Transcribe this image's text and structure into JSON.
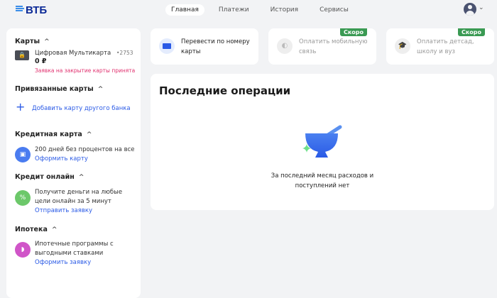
{
  "header": {
    "logo": "ВТБ",
    "nav": [
      "Главная",
      "Платежи",
      "История",
      "Сервисы"
    ]
  },
  "sidebar": {
    "cards": {
      "title": "Карты",
      "card_name": "Цифровая Мультикарта",
      "card_number": "•2753",
      "balance": "0 ₽",
      "notice": "Заявка на закрытие карты принята"
    },
    "linked": {
      "title": "Привязанные карты",
      "add": "Добавить карту другого банка"
    },
    "credit_card": {
      "title": "Кредитная карта",
      "text": "200 дней без процентов на все",
      "link": "Оформить карту"
    },
    "credit_online": {
      "title": "Кредит онлайн",
      "text1": "Получите деньги на любые",
      "text2": "цели онлайн за 5 минут",
      "link": "Отправить заявку"
    },
    "mortgage": {
      "title": "Ипотека",
      "text1": "Ипотечные программы с",
      "text2": "выгодными ставками",
      "link": "Оформить заявку"
    }
  },
  "quick": [
    {
      "l1": "Перевести по номеру",
      "l2": "карты"
    },
    {
      "l1": "Оплатить мобильную",
      "l2": "связь",
      "badge": "Скоро"
    },
    {
      "l1": "Оплатить детсад,",
      "l2": "школу и вуз",
      "badge": "Скоро"
    }
  ],
  "operations": {
    "title": "Последние операции",
    "empty1": "За последний месяц расходов и",
    "empty2": "поступлений нет"
  },
  "colors": {
    "accent": "#2a5ae6",
    "badge": "#3a9a53",
    "notice": "#e0306e"
  }
}
